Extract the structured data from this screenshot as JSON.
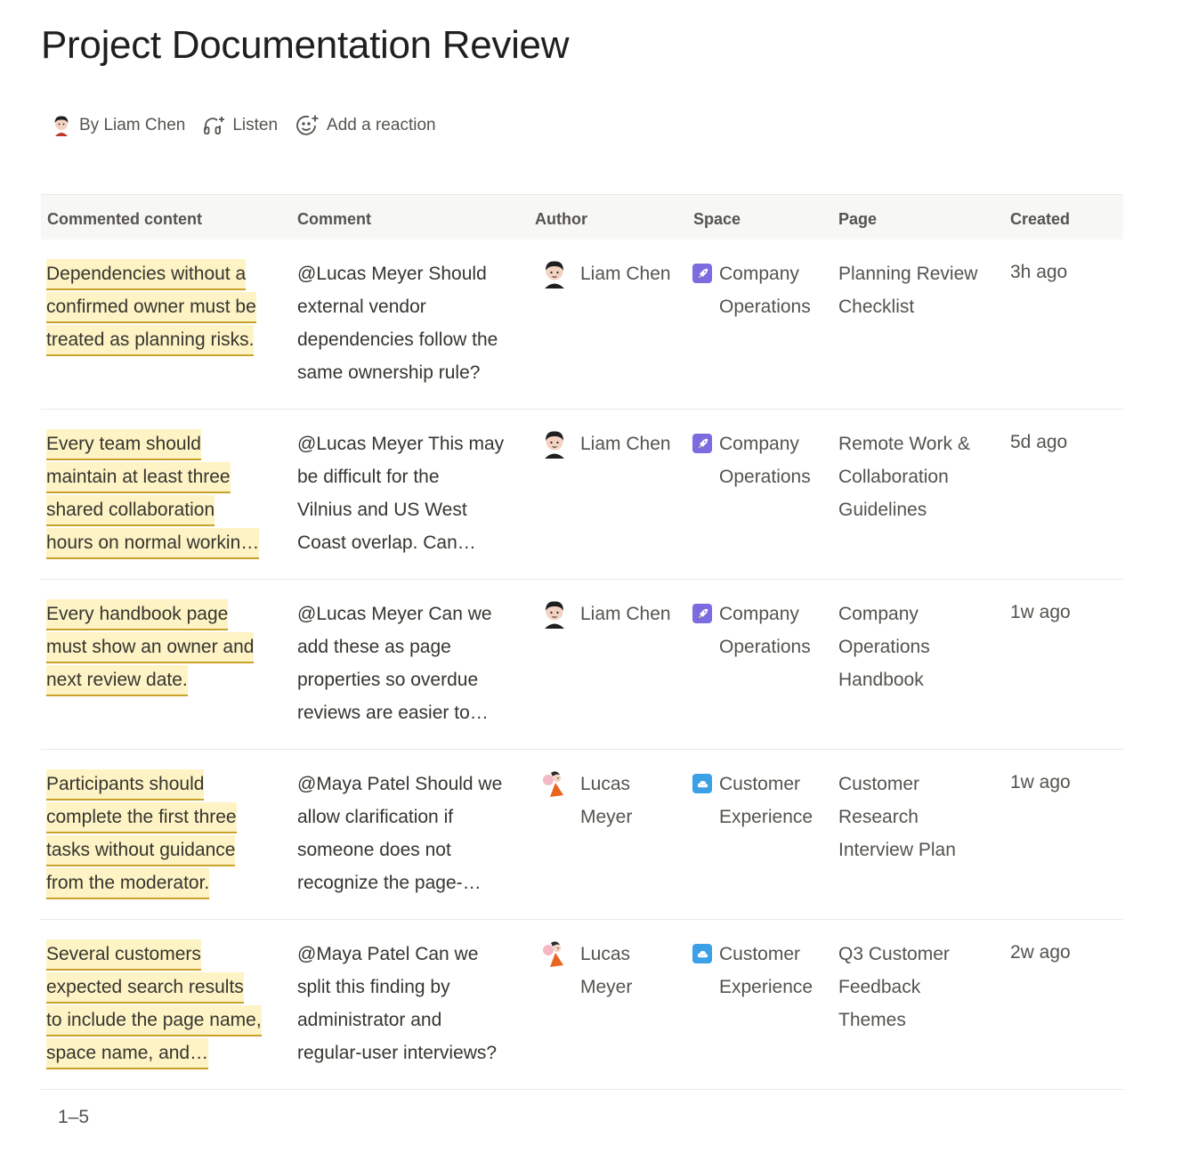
{
  "page": {
    "title": "Project Documentation Review"
  },
  "meta": {
    "author_label": "By Liam Chen",
    "listen_label": "Listen",
    "reaction_label": "Add a reaction"
  },
  "table": {
    "columns": [
      "Commented content",
      "Comment",
      "Author",
      "Space",
      "Page",
      "Created"
    ],
    "rows": [
      {
        "content": [
          "Dependencies without a",
          "confirmed owner must be",
          "treated as planning risks."
        ],
        "comment": [
          "@Lucas Meyer Should",
          "external vendor",
          "dependencies follow the",
          "same ownership rule?"
        ],
        "author": [
          "Liam Chen"
        ],
        "author_icon": "avatar-liam-icon",
        "space": [
          "Company",
          "Operations"
        ],
        "space_icon": "rocket-icon",
        "page": [
          "Planning Review",
          "Checklist"
        ],
        "created": "3h ago"
      },
      {
        "content": [
          "Every team should",
          "maintain at least three",
          "shared collaboration",
          "hours on normal workin…"
        ],
        "comment": [
          "@Lucas Meyer This may",
          "be difficult for the",
          "Vilnius and US West",
          "Coast overlap. Can…"
        ],
        "author": [
          "Liam Chen"
        ],
        "author_icon": "avatar-liam-icon",
        "space": [
          "Company",
          "Operations"
        ],
        "space_icon": "rocket-icon",
        "page": [
          "Remote Work &",
          "Collaboration",
          "Guidelines"
        ],
        "created": "5d ago"
      },
      {
        "content": [
          "Every handbook page",
          "must show an owner and",
          "next review date."
        ],
        "comment": [
          "@Lucas Meyer Can we",
          "add these as page",
          "properties so overdue",
          "reviews are easier to…"
        ],
        "author": [
          "Liam Chen"
        ],
        "author_icon": "avatar-liam-icon",
        "space": [
          "Company",
          "Operations"
        ],
        "space_icon": "rocket-icon",
        "page": [
          "Company",
          "Operations",
          "Handbook"
        ],
        "created": "1w ago"
      },
      {
        "content": [
          "Participants should",
          "complete the first three",
          "tasks without guidance",
          "from the moderator."
        ],
        "comment": [
          "@Maya Patel Should we",
          "allow clarification if",
          "someone does not",
          "recognize the page-…"
        ],
        "author": [
          "Lucas",
          "Meyer"
        ],
        "author_icon": "avatar-lucas-icon",
        "space": [
          "Customer",
          "Experience"
        ],
        "space_icon": "cloud-icon",
        "page": [
          "Customer",
          "Research",
          "Interview Plan"
        ],
        "created": "1w ago"
      },
      {
        "content": [
          "Several customers",
          "expected search results",
          "to include the page name,",
          "space name, and…"
        ],
        "comment": [
          "@Maya Patel Can we",
          "split this finding by",
          "administrator and",
          "regular-user interviews?"
        ],
        "author": [
          "Lucas",
          "Meyer"
        ],
        "author_icon": "avatar-lucas-icon",
        "space": [
          "Customer",
          "Experience"
        ],
        "space_icon": "cloud-icon",
        "page": [
          "Q3 Customer",
          "Feedback",
          "Themes"
        ],
        "created": "2w ago"
      }
    ]
  },
  "pagination": {
    "range": "1–5"
  },
  "colors": {
    "highlight_bg": "#fdf3c4",
    "highlight_underline": "#c9a227",
    "space_ops": "#7b6ce0",
    "space_cx": "#3ca0e6"
  }
}
